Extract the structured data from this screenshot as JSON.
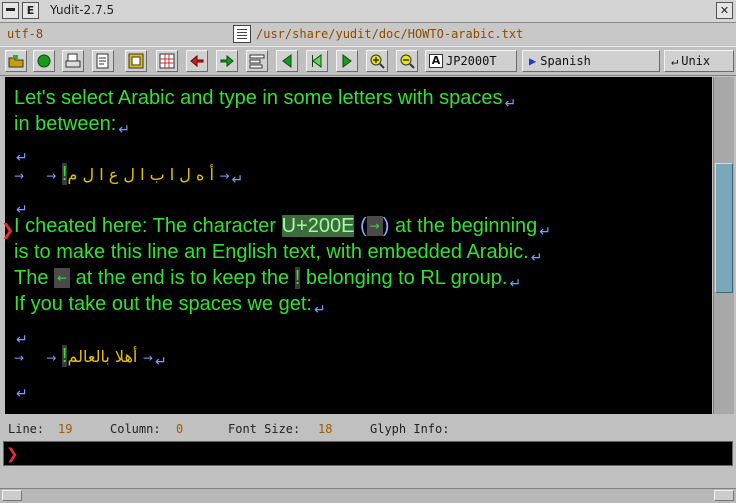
{
  "window": {
    "title": "Yudit-2.7.5",
    "menu_letter": "E",
    "close_glyph": "✕"
  },
  "info": {
    "encoding": "utf-8",
    "file_path": "/usr/share/yudit/doc/HOWTO-arabic.txt"
  },
  "toolbar": {
    "font_label": "JP2000T",
    "language_label": "Spanish",
    "line_ending_label": "Unix"
  },
  "editor": {
    "line1": "Let's select Arabic and type in some letters with spaces",
    "line2": "in between:",
    "arabic_spaced": "أ ه ل ا   ب ا ل ع ا ل م",
    "excl": "!",
    "line_cheat_pre": "I cheated here: The character ",
    "code": "U+200E",
    "line_cheat_post": " at the beginning",
    "line_cheat2": "is to make this line an English text, with embedded Arabic.",
    "line_the_pre": "The ",
    "line_the_mid": " at the end is to keep the ",
    "line_the_post": " belonging to RL group.",
    "line_spaces": "If you take out the spaces we get:",
    "arabic_joined": "أهلا بالعالم",
    "ret": "↵",
    "tab": "→",
    "lrm_glyph": "→",
    "rlm_glyph": "←",
    "open_paren": "(",
    "close_paren": ")"
  },
  "status": {
    "line_label": "Line:",
    "line_value": "19",
    "column_label": "Column:",
    "column_value": "0",
    "font_size_label": "Font Size:",
    "font_size_value": "18",
    "glyph_info_label": "Glyph Info:"
  },
  "colors": {
    "editor_bg": "#000000",
    "text": "#33e033",
    "arabic": "#e4c400",
    "control_marks": "#7aa0ff",
    "cursor": "#e03030"
  }
}
